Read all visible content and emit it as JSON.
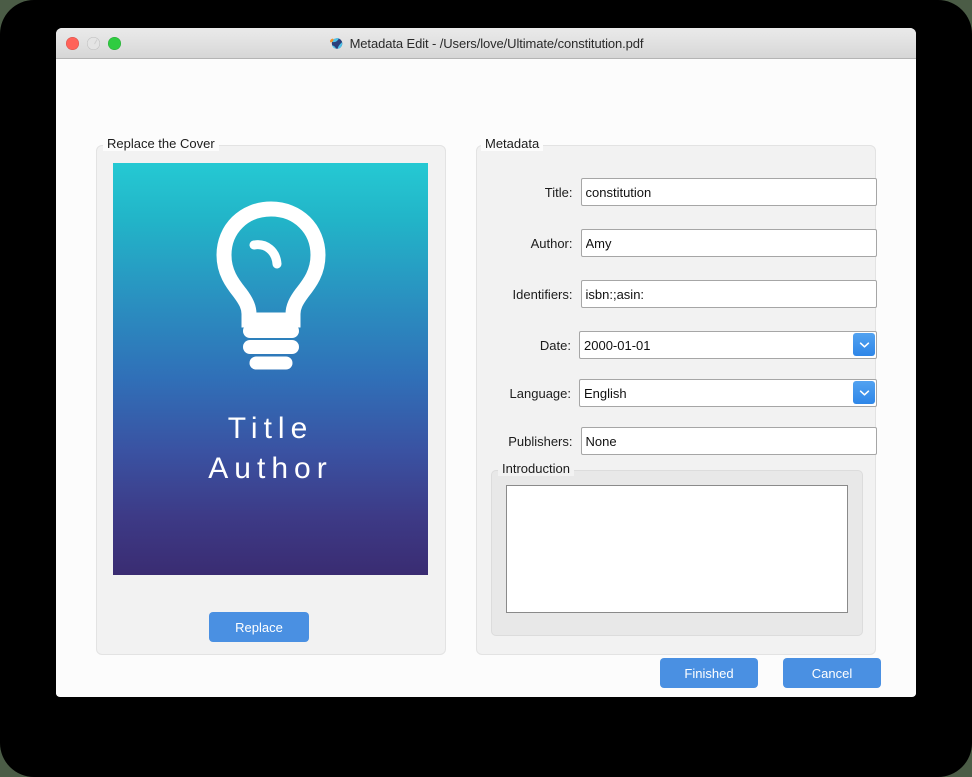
{
  "window": {
    "title": "Metadata Edit - /Users/love/Ultimate/constitution.pdf",
    "app_icon": "globe-icon",
    "traffic_lights": {
      "close": "close-button",
      "minimize": "minimize-button",
      "maximize": "maximize-button"
    }
  },
  "cover_panel": {
    "legend": "Replace the Cover",
    "cover": {
      "icon": "lightbulb-icon",
      "title_text": "Title",
      "author_text": "Author",
      "gradient_top": "#25c9d3",
      "gradient_bottom": "#3a2c72"
    },
    "replace_label": "Replace"
  },
  "metadata_panel": {
    "legend": "Metadata",
    "fields": [
      {
        "label": "Title:",
        "value": "constitution",
        "type": "text"
      },
      {
        "label": "Author:",
        "value": "Amy",
        "type": "text"
      },
      {
        "label": "Identifiers:",
        "value": "isbn:;asin:",
        "type": "text"
      },
      {
        "label": "Date:",
        "value": "2000-01-01",
        "type": "combo"
      },
      {
        "label": "Language:",
        "value": "English",
        "type": "combo"
      },
      {
        "label": "Publishers:",
        "value": "None",
        "type": "text"
      }
    ],
    "introduction": {
      "legend": "Introduction",
      "value": ""
    }
  },
  "footer": {
    "finished_label": "Finished",
    "cancel_label": "Cancel"
  },
  "colors": {
    "accent_blue": "#4a90e2",
    "panel_gray": "#f2f2f2",
    "window_bg": "#fcfcfc",
    "desktop_bg": "#4b5c46"
  }
}
